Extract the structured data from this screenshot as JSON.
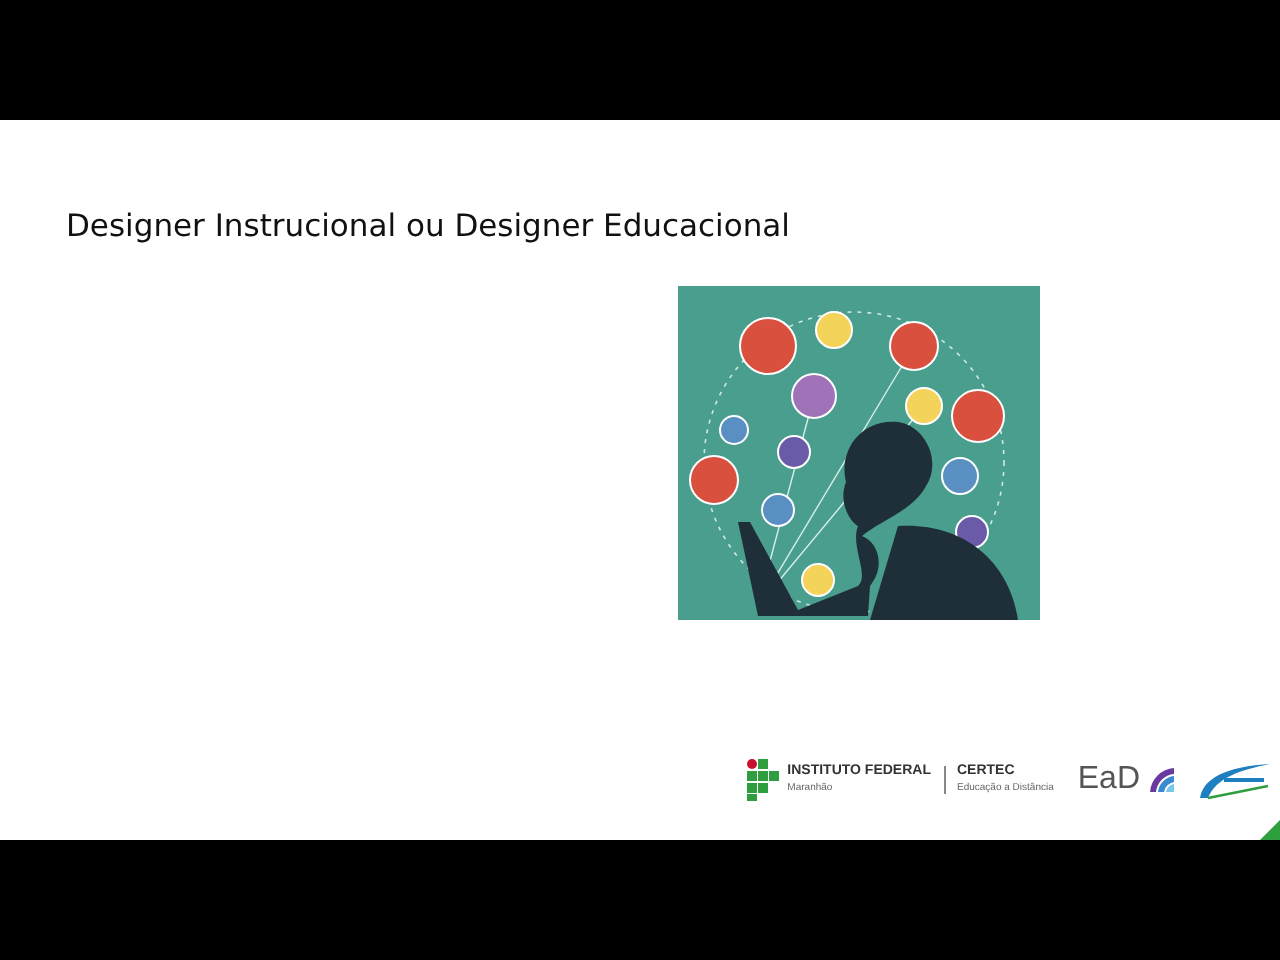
{
  "slide": {
    "title": "Designer Instrucional ou Designer Educacional"
  },
  "footer": {
    "institute": {
      "name": "INSTITUTO FEDERAL",
      "campus": "Maranhão"
    },
    "certec": {
      "name": "CERTEC",
      "subtitle": "Educação a Distância"
    },
    "ead": {
      "name": "EaD"
    }
  }
}
